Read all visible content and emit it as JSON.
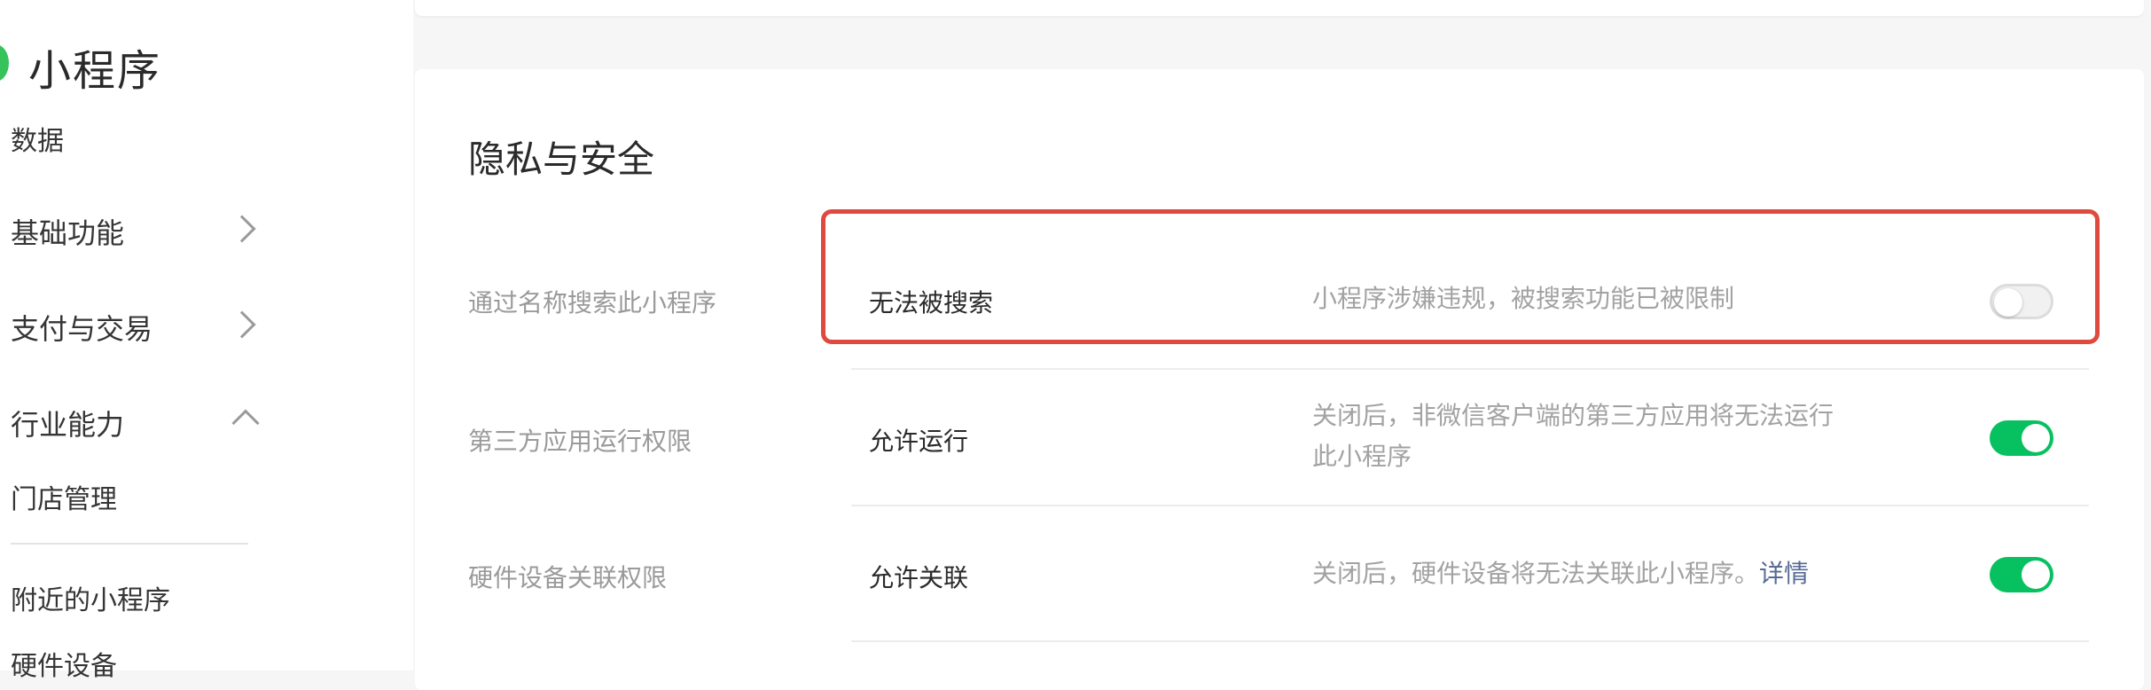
{
  "sidebar": {
    "brand": "小程序",
    "items": [
      {
        "label": "数据"
      },
      {
        "label": "基础功能"
      },
      {
        "label": "支付与交易"
      },
      {
        "label": "行业能力"
      },
      {
        "label": "门店管理"
      },
      {
        "label": "附近的小程序"
      },
      {
        "label": "硬件设备"
      }
    ]
  },
  "section": {
    "title": "隐私与安全",
    "rows": [
      {
        "label": "通过名称搜索此小程序",
        "value": "无法被搜索",
        "desc": "小程序涉嫌违规，被搜索功能已被限制",
        "toggle": "off"
      },
      {
        "label": "第三方应用运行权限",
        "value": "允许运行",
        "desc_line1": "关闭后，非微信客户端的第三方应用将无法运行",
        "desc_line2": "此小程序",
        "toggle": "on"
      },
      {
        "label": "硬件设备关联权限",
        "value": "允许关联",
        "desc": "关闭后，硬件设备将无法关联此小程序。",
        "link": "详情",
        "toggle": "on"
      }
    ]
  },
  "colors": {
    "toggle_on": "#07c160",
    "highlight": "#e0493d",
    "link": "#576b95"
  }
}
